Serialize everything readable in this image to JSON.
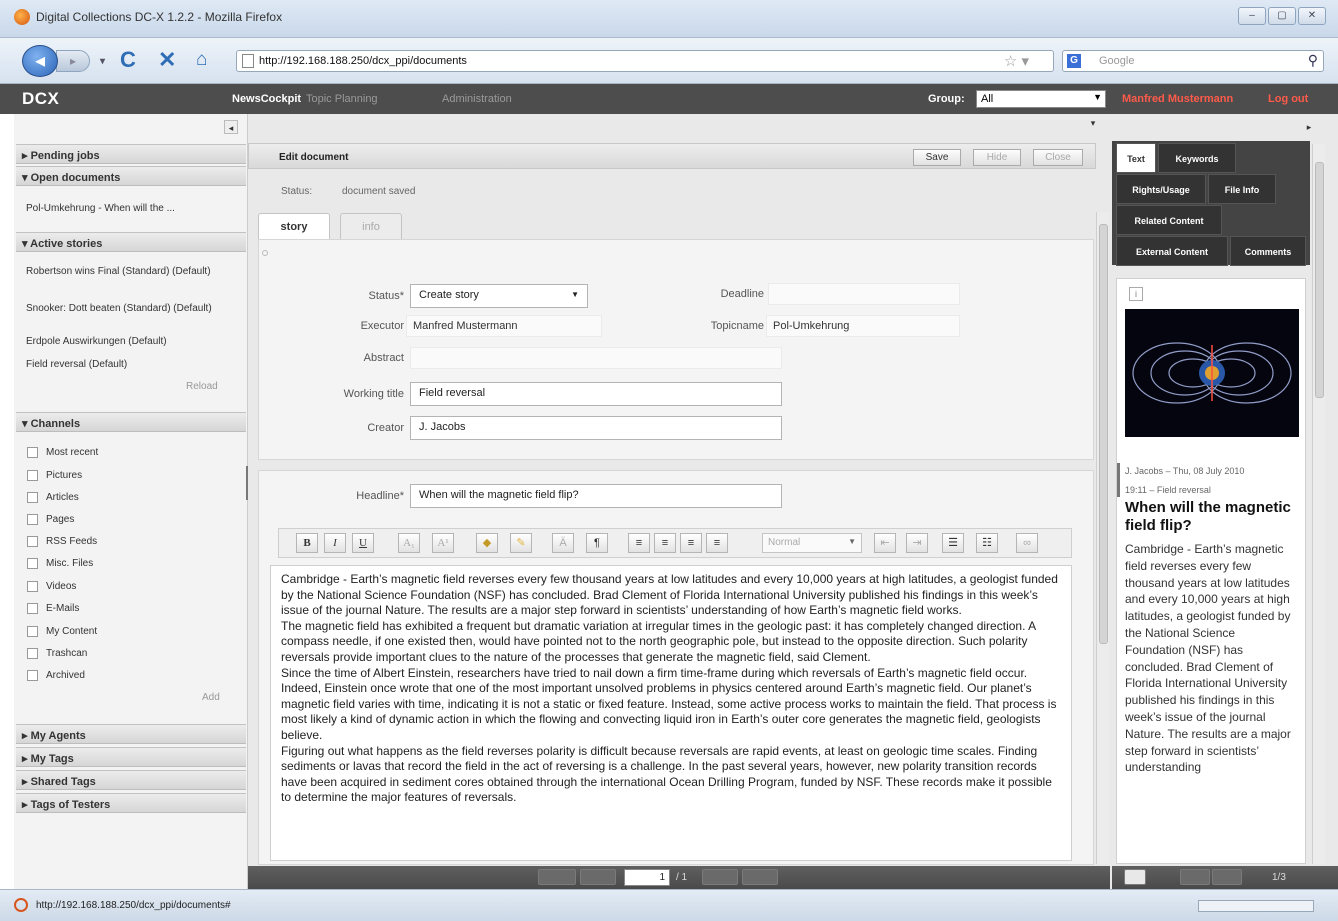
{
  "window": {
    "title": "Digital Collections DC-X 1.2.2 - Mozilla Firefox",
    "buttons": [
      "–",
      "▢",
      "✕"
    ]
  },
  "browser": {
    "url": "http://192.168.188.250/dcx_ppi/documents",
    "search_placeholder": "Google",
    "status_url": "http://192.168.188.250/dcx_ppi/documents#"
  },
  "app": {
    "logo": "DCX",
    "menu": [
      "NewsCockpit",
      "Topic Planning",
      "Administration"
    ],
    "group_label": "Group:",
    "group_value": "All",
    "user": "Manfred Mustermann",
    "logout": "Log out"
  },
  "sidebar": {
    "pending_jobs": "Pending jobs",
    "open_documents": "Open documents",
    "open_items": [
      "Pol-Umkehrung - When will the ..."
    ],
    "active_stories": "Active stories",
    "story_items": [
      "Robertson wins Final (Standard) (Default)",
      "Snooker: Dott beaten (Standard) (Default)",
      "Erdpole Auswirkungen (Default)",
      "Field reversal (Default)"
    ],
    "reload": "Reload",
    "channels": "Channels",
    "channel_items": [
      "Most recent",
      "Pictures",
      "Articles",
      "Pages",
      "RSS Feeds",
      "Misc. Files",
      "Videos",
      "E-Mails",
      "My Content",
      "Trashcan",
      "Archived"
    ],
    "add": "Add",
    "my_agents": "My Agents",
    "my_tags": "My Tags",
    "shared_tags": "Shared Tags",
    "tags_of_testers": "Tags of Testers"
  },
  "editor": {
    "header": "Edit document",
    "save": "Save",
    "hide": "Hide",
    "close": "Close",
    "status_label": "Status:",
    "status_value": "document saved",
    "tabs": [
      "story",
      "info"
    ],
    "form": {
      "status_label": "Status*",
      "status_value": "Create story",
      "deadline_label": "Deadline",
      "executor_label": "Executor",
      "executor_value": "Manfred Mustermann",
      "topicname_label": "Topicname",
      "topicname_value": "Pol-Umkehrung",
      "abstract_label": "Abstract",
      "working_title_label": "Working title",
      "working_title_value": "Field reversal",
      "creator_label": "Creator",
      "creator_value": "J. Jacobs",
      "headline_label": "Headline*",
      "headline_value": "When will the magnetic field flip?"
    },
    "toolbar": {
      "bold": "B",
      "italic": "I",
      "underline": "U",
      "subscript": "A₁",
      "superscript": "A¹",
      "paragraph": "¶",
      "format_value": "Normal"
    },
    "body": [
      "Cambridge - Earth’s magnetic field reverses every few thousand years at low latitudes and every 10,000 years at high latitudes, a geologist funded by the National Science Foundation (NSF) has concluded. Brad Clement of Florida International University published his findings in this week’s issue of the journal Nature. The results are a major step forward in scientists’ understanding of how Earth’s magnetic field works.",
      "The magnetic field has exhibited a frequent but dramatic variation at irregular times in the geologic past: it has completely changed direction. A compass needle, if one existed then, would have pointed not to the north geographic pole, but instead to the opposite direction. Such polarity reversals provide important clues to the nature of the processes that generate the magnetic field, said Clement.",
      "Since the time of Albert Einstein, researchers have tried to nail down a firm time-frame during which reversals of Earth’s magnetic field occur. Indeed, Einstein once wrote that one of the most important unsolved problems in physics centered around Earth’s magnetic field. Our planet’s magnetic field varies with time, indicating it is not a static or fixed feature. Instead, some active process works to maintain the field. That process is most likely a kind of dynamic action in which the flowing and convecting liquid iron in Earth’s outer core generates the magnetic field, geologists believe.",
      "Figuring out what happens as the field reverses polarity is difficult because reversals are rapid events, at least on geologic time scales. Finding sediments or lavas that record the field in the act of reversing is a challenge. In the past several years, however, new polarity transition records have been acquired in sediment cores obtained through the international Ocean Drilling Program, funded by NSF. These records make it possible to determine the major features of reversals."
    ],
    "pager_current": "1",
    "pager_total": "/ 1"
  },
  "right": {
    "tabs": [
      "Text",
      "Keywords",
      "Rights/Usage",
      "File Info",
      "Related Content",
      "External Content",
      "Comments"
    ],
    "meta_line1": "J. Jacobs – Thu, 08 July 2010",
    "meta_line2": "19:11 – Field reversal",
    "title": "When will the magnetic field flip?",
    "body": "Cambridge - Earth’s magnetic field reverses every few thousand years at low latitudes and every 10,000 years at high latitudes, a geologist funded by the National Science Foundation (NSF) has concluded. Brad Clement of Florida International University published his findings in this week’s issue of the journal Nature. The results are a major step forward in scientists’ understanding",
    "pager": "1/3"
  }
}
